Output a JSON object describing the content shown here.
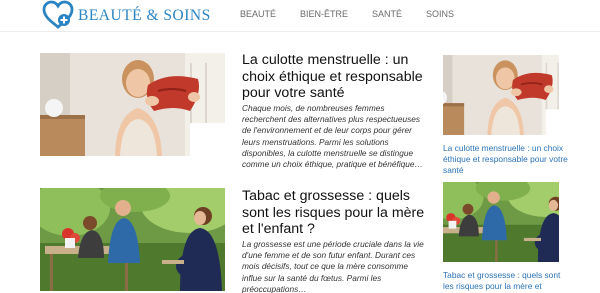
{
  "site": {
    "name": "BEAUTÉ & SOINS",
    "brand_color": "#2a84c3",
    "logo_icon": "heart-plus-icon"
  },
  "nav": {
    "items": [
      "BEAUTÉ",
      "BIEN-ÊTRE",
      "SANTÉ",
      "SOINS"
    ]
  },
  "articles": [
    {
      "title": "La culotte menstruelle : un choix éthique et responsable pour votre santé",
      "excerpt": "Chaque mois, de nombreuses femmes recherchent des alternatives plus respectueuses de l'environnement et de leur corps pour gérer leurs menstruations. Parmi les solutions disponibles, la culotte menstruelle se distingue comme un choix éthique, pratique et bénéfique…",
      "image": "woman-holding-red-underwear-photo"
    },
    {
      "title": "Tabac et grossesse : quels sont les risques pour la mère et l'enfant ?",
      "excerpt": "La grossesse est une période cruciale dans la vie d'une femme et de son futur enfant. Durant ces mois décisifs, tout ce que la mère consomme influe sur la santé du fœtus. Parmi les préoccupations…",
      "image": "pregnant-woman-outdoor-table-photo"
    }
  ],
  "sidebar": {
    "items": [
      {
        "title": "La culotte menstruelle : un choix éthique et responsable pour votre santé",
        "image": "woman-holding-red-underwear-photo"
      },
      {
        "title": "Tabac et grossesse : quels sont les risques pour la mère et l'enfant ?",
        "image": "pregnant-woman-outdoor-table-photo"
      }
    ],
    "link_color": "#2b73b5"
  }
}
